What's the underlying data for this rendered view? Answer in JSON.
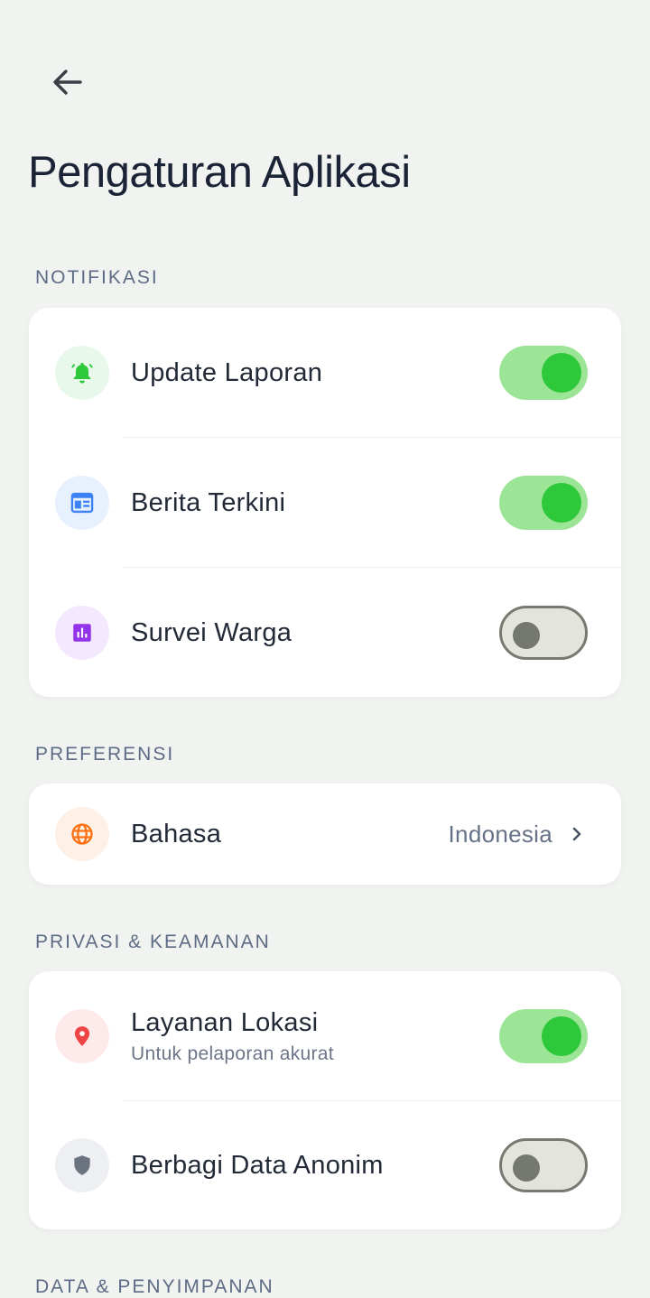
{
  "header": {
    "title": "Pengaturan Aplikasi"
  },
  "sections": {
    "notifikasi": {
      "label": "NOTIFIKASI",
      "items": [
        {
          "label": "Update Laporan",
          "icon": "bell-icon",
          "toggle_on": true
        },
        {
          "label": "Berita Terkini",
          "icon": "newspaper-icon",
          "toggle_on": true
        },
        {
          "label": "Survei Warga",
          "icon": "poll-icon",
          "toggle_on": false
        }
      ]
    },
    "preferensi": {
      "label": "PREFERENSI",
      "items": [
        {
          "label": "Bahasa",
          "icon": "globe-icon",
          "value": "Indonesia"
        }
      ]
    },
    "privasi": {
      "label": "PRIVASI & KEAMANAN",
      "items": [
        {
          "label": "Layanan Lokasi",
          "sublabel": "Untuk pelaporan akurat",
          "icon": "location-pin-icon",
          "toggle_on": true
        },
        {
          "label": "Berbagi Data Anonim",
          "icon": "shield-icon",
          "toggle_on": false
        }
      ]
    },
    "data": {
      "label": "DATA & PENYIMPANAN"
    }
  },
  "colors": {
    "toggle_on_track": "#9ce496",
    "toggle_on_knob": "#2ec93b",
    "toggle_off_track": "#e3e5dc",
    "toggle_off_knob": "#747870"
  }
}
